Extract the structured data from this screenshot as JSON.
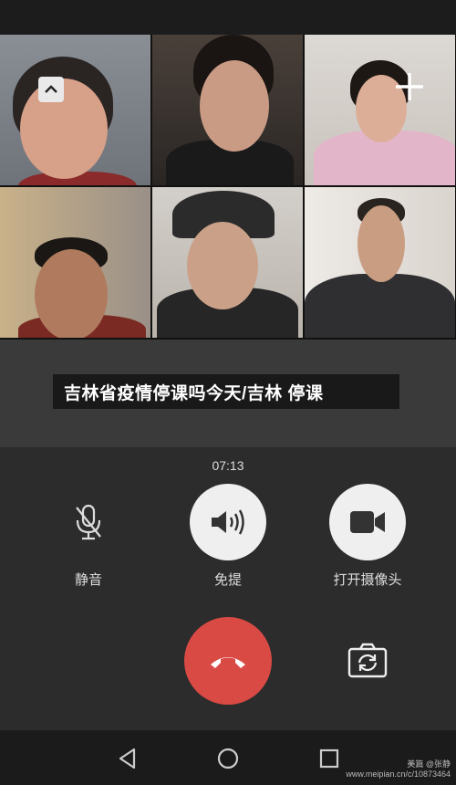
{
  "status_bar": {
    "time": ""
  },
  "grid": {
    "participants": [
      {
        "name": "participant-1",
        "bg": "#7a7f88"
      },
      {
        "name": "participant-2",
        "bg": "#3a3430"
      },
      {
        "name": "participant-3",
        "bg": "#d7d2cd"
      },
      {
        "name": "participant-4",
        "bg": "#b7a48a"
      },
      {
        "name": "participant-5",
        "bg": "#c7c2bb"
      },
      {
        "name": "participant-6",
        "bg": "#ebe9e4"
      }
    ]
  },
  "caption": {
    "text": "吉林省疫情停课吗今天/吉林 停课"
  },
  "call": {
    "duration": "07:13"
  },
  "controls": {
    "mute_label": "静音",
    "speaker_label": "免提",
    "camera_label": "打开摄像头"
  },
  "watermark": {
    "line1": "美篇 @张静",
    "line2": "www.meipian.cn/c/10873464"
  },
  "colors": {
    "hangup": "#d94a45",
    "panel": "#2c2c2c"
  },
  "icons": [
    "chevron-up-icon",
    "plus-icon",
    "mic-off-icon",
    "speaker-icon",
    "video-camera-icon",
    "hangup-icon",
    "switch-camera-icon",
    "back-icon",
    "home-icon",
    "recents-icon"
  ]
}
